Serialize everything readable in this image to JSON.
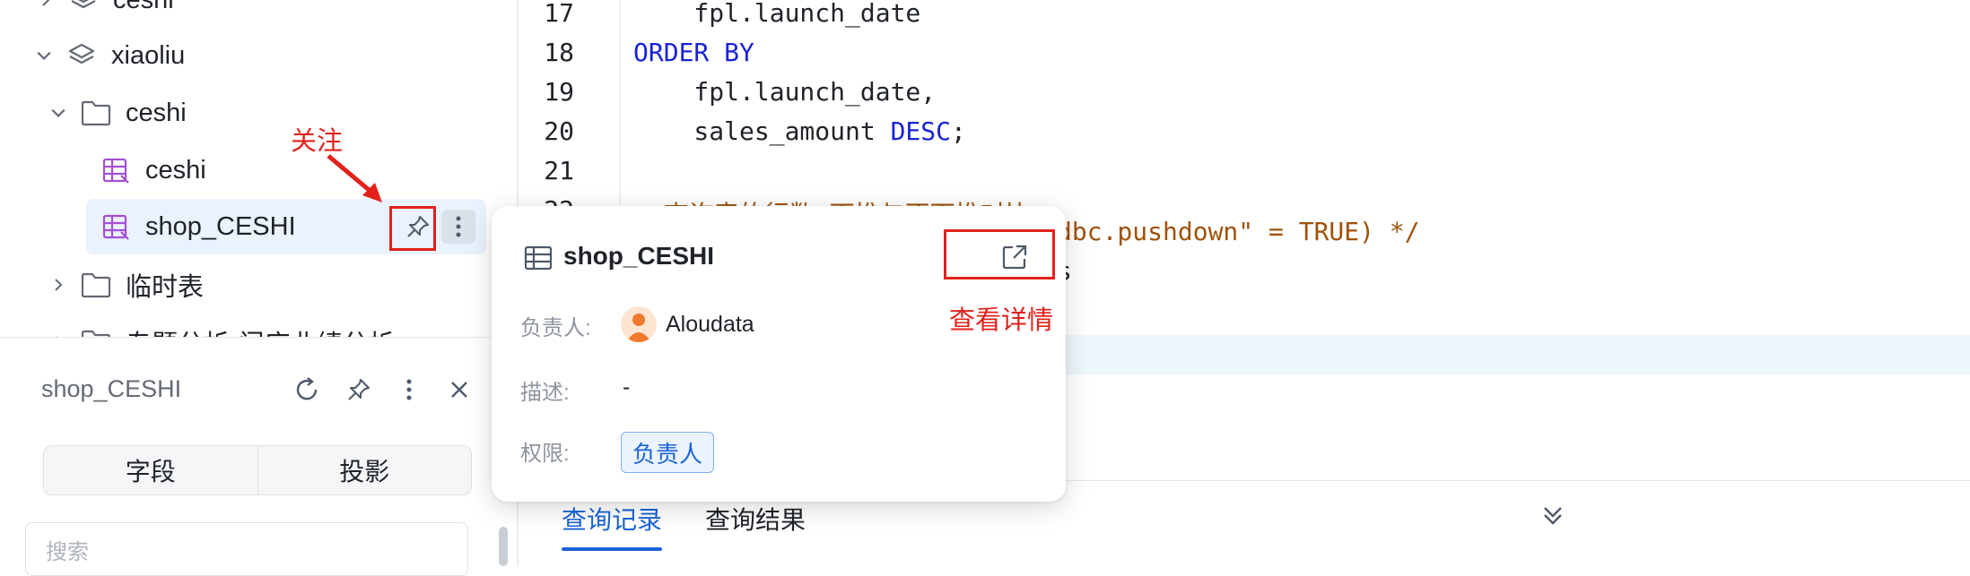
{
  "tree": {
    "items": [
      {
        "label": "ceshi",
        "kind": "schema"
      },
      {
        "label": "xiaoliu",
        "kind": "schema"
      },
      {
        "label": "ceshi",
        "kind": "folder"
      },
      {
        "label": "ceshi",
        "kind": "table"
      },
      {
        "label": "shop_CESHI",
        "kind": "table",
        "selected": true
      },
      {
        "label": "临时表",
        "kind": "folder"
      },
      {
        "label": "专题分析-门店业绩分析",
        "kind": "folder"
      }
    ]
  },
  "annotations": {
    "pin_label": "关注",
    "details_label": "查看详情",
    "color": "#e2211c"
  },
  "detail_panel": {
    "title": "shop_CESHI",
    "segments": [
      "字段",
      "投影"
    ],
    "search_placeholder": "搜索"
  },
  "editor": {
    "lines": [
      {
        "n": "17",
        "segs": [
          {
            "t": "    fpl.launch_date",
            "c": ""
          }
        ]
      },
      {
        "n": "18",
        "segs": [
          {
            "t": "ORDER BY",
            "c": "kw"
          }
        ]
      },
      {
        "n": "19",
        "segs": [
          {
            "t": "    fpl.launch_date,",
            "c": ""
          }
        ]
      },
      {
        "n": "20",
        "segs": [
          {
            "t": "    sales_amount ",
            "c": ""
          },
          {
            "t": "DESC",
            "c": "kw"
          },
          {
            "t": ";",
            "c": ""
          }
        ]
      },
      {
        "n": "21",
        "segs": []
      },
      {
        "n": "22",
        "segs": [
          {
            "t": "--查询表的行数-下推与不下推对比",
            "c": "cm"
          }
        ]
      }
    ],
    "partial": [
      {
        "t": "dbc.pushdown\" = TRUE) */",
        "c": "cm"
      },
      {
        "t": "s",
        "c": ""
      }
    ]
  },
  "bottom_tabs": [
    "查询记录",
    "查询结果"
  ],
  "popover": {
    "title": "shop_CESHI",
    "owner_label": "负责人:",
    "owner": "Aloudata",
    "desc_label": "描述:",
    "desc": "-",
    "perm_label": "权限:",
    "perm": "负责人"
  },
  "colors": {
    "accent": "#1c64d6",
    "selected_bg": "#eaf2fd",
    "table_icon": "#a44fd6"
  }
}
